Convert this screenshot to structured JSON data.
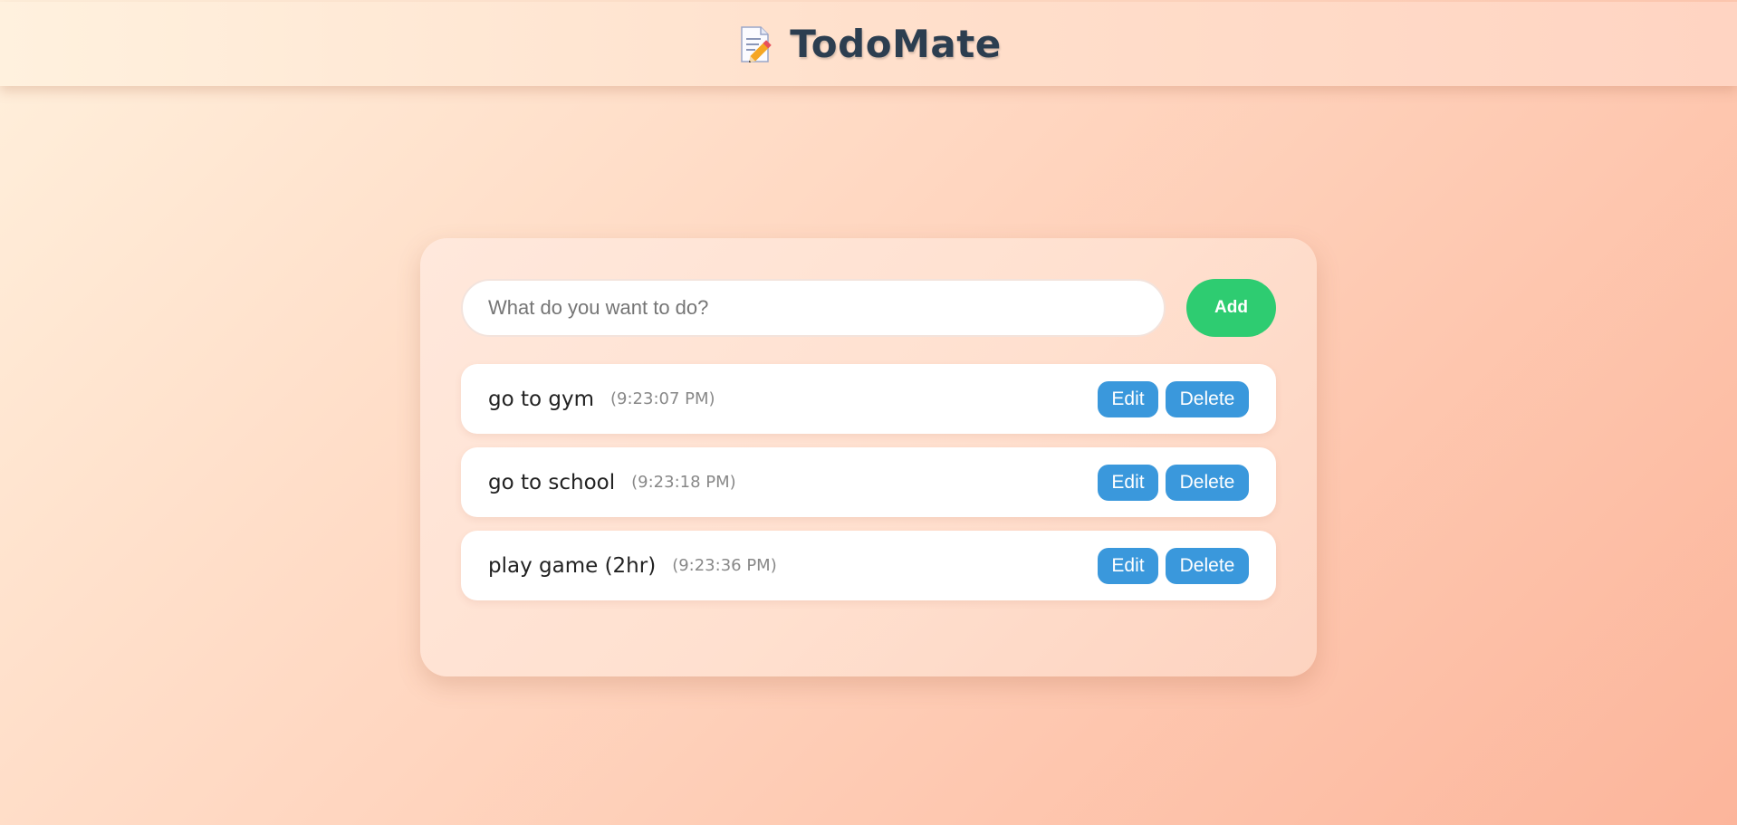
{
  "header": {
    "title": "TodoMate",
    "logo_icon": "memo-pencil-icon"
  },
  "form": {
    "input_placeholder": "What do you want to do?",
    "input_value": "",
    "add_label": "Add"
  },
  "todos": [
    {
      "text": "go to gym",
      "time": "(9:23:07 PM)",
      "edit_label": "Edit",
      "delete_label": "Delete"
    },
    {
      "text": "go to school",
      "time": "(9:23:18 PM)",
      "edit_label": "Edit",
      "delete_label": "Delete"
    },
    {
      "text": "play game (2hr)",
      "time": "(9:23:36 PM)",
      "edit_label": "Edit",
      "delete_label": "Delete"
    }
  ],
  "colors": {
    "add_button": "#2ecc71",
    "action_button": "#3a98dc",
    "title": "#2c3e50"
  }
}
